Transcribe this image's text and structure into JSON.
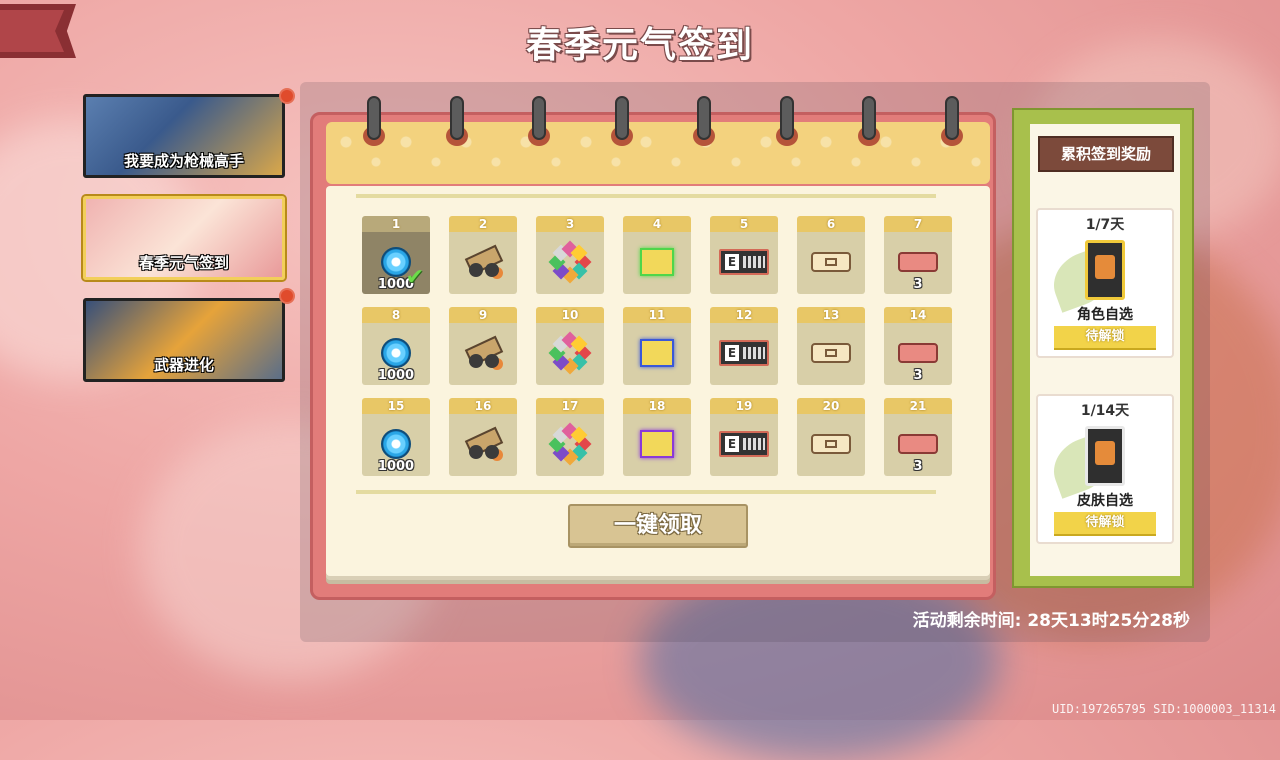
{
  "title": "春季元气签到",
  "colors": {
    "accent": "#f2cf5a",
    "calendar_frame": "#e27c7a",
    "calendar_header": "#f3d27e",
    "right_frame": "#a8c04c"
  },
  "menu": [
    {
      "label": "我要成为枪械高手",
      "active": false,
      "has_dot": true
    },
    {
      "label": "春季元气签到",
      "active": true,
      "has_dot": false
    },
    {
      "label": "武器进化",
      "active": false,
      "has_dot": true
    }
  ],
  "days": [
    {
      "day": "1",
      "item": "gem-icon",
      "count": "1000",
      "claimed": true
    },
    {
      "day": "2",
      "item": "cannon-icon",
      "count": "",
      "claimed": false
    },
    {
      "day": "3",
      "item": "leaves-icon",
      "count": "",
      "claimed": false
    },
    {
      "day": "4",
      "item": "green-scroll-icon",
      "count": "",
      "claimed": false
    },
    {
      "day": "5",
      "item": "card-icon",
      "count": "",
      "claimed": false
    },
    {
      "day": "6",
      "item": "ticket-icon",
      "count": "",
      "claimed": false
    },
    {
      "day": "7",
      "item": "red-ticket-icon",
      "count": "3",
      "claimed": false
    },
    {
      "day": "8",
      "item": "gem-icon",
      "count": "1000",
      "claimed": false
    },
    {
      "day": "9",
      "item": "cannon-icon",
      "count": "",
      "claimed": false
    },
    {
      "day": "10",
      "item": "leaves-icon",
      "count": "",
      "claimed": false
    },
    {
      "day": "11",
      "item": "blue-scroll-icon",
      "count": "",
      "claimed": false
    },
    {
      "day": "12",
      "item": "card-icon",
      "count": "",
      "claimed": false
    },
    {
      "day": "13",
      "item": "ticket-icon",
      "count": "",
      "claimed": false
    },
    {
      "day": "14",
      "item": "red-ticket-icon",
      "count": "3",
      "claimed": false
    },
    {
      "day": "15",
      "item": "gem-icon",
      "count": "1000",
      "claimed": false
    },
    {
      "day": "16",
      "item": "cannon-icon",
      "count": "",
      "claimed": false
    },
    {
      "day": "17",
      "item": "leaves-icon",
      "count": "",
      "claimed": false
    },
    {
      "day": "18",
      "item": "purple-scroll-icon",
      "count": "",
      "claimed": false
    },
    {
      "day": "19",
      "item": "card-icon",
      "count": "",
      "claimed": false
    },
    {
      "day": "20",
      "item": "ticket-icon",
      "count": "",
      "claimed": false
    },
    {
      "day": "21",
      "item": "red-ticket-icon",
      "count": "3",
      "claimed": false
    }
  ],
  "claim_all_label": "一键领取",
  "cumulative": {
    "title": "累积签到奖励",
    "rewards": [
      {
        "progress": "1/7天",
        "name": "角色自选",
        "status": "待解锁"
      },
      {
        "progress": "1/14天",
        "name": "皮肤自选",
        "status": "待解锁"
      }
    ]
  },
  "timer_text": "活动剩余时间: 28天13时25分28秒",
  "uid_text": "UID:197265795 SID:1000003_11314"
}
